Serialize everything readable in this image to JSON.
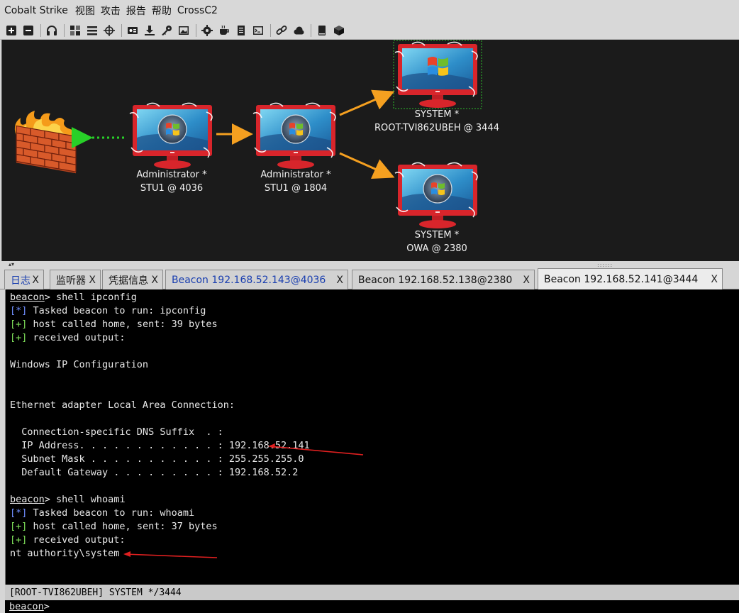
{
  "menu": {
    "items": [
      "Cobalt Strike",
      "视图",
      "攻击",
      "报告",
      "帮助",
      "CrossC2"
    ]
  },
  "toolbar": {
    "icons": [
      "add-icon",
      "remove-icon",
      "headphones-icon",
      "network-icon",
      "list-icon",
      "crosshair-icon",
      "credentials-icon",
      "download-icon",
      "key-icon",
      "image-icon",
      "gear-icon",
      "coffee-icon",
      "document-icon",
      "terminal-icon",
      "link-icon",
      "cloud-icon",
      "book-icon",
      "cube-icon"
    ]
  },
  "graph": {
    "nodes": [
      {
        "user": "Administrator *",
        "host": "STU1 @ 4036"
      },
      {
        "user": "Administrator *",
        "host": "STU1 @ 1804"
      },
      {
        "user": "SYSTEM *",
        "host": "ROOT-TVI862UBEH @ 3444"
      },
      {
        "user": "SYSTEM *",
        "host": "OWA @ 2380"
      }
    ],
    "colors": {
      "background": "#1b1b1b",
      "pivot_arrow": "#f5a020",
      "egress_arrow": "#28d028",
      "monitor": "#d8252b",
      "selection": "#2dbb2d"
    }
  },
  "tabs": [
    {
      "label": "日志",
      "close": "X"
    },
    {
      "label": "监听器",
      "close": "X"
    },
    {
      "label": "凭据信息",
      "close": "X"
    },
    {
      "label": "Beacon 192.168.52.143@4036",
      "close": "X"
    },
    {
      "label": "Beacon 192.168.52.138@2380",
      "close": "X"
    },
    {
      "label": "Beacon 192.168.52.141@3444",
      "close": "X"
    }
  ],
  "console": {
    "prompt": "beacon",
    "cmd1": "> shell ipconfig",
    "tasked_tag": "[*]",
    "ok_tag": "[+]",
    "task1": " Tasked beacon to run: ipconfig",
    "host1": " host called home, sent: 39 bytes",
    "recv": " received output:",
    "winip": "Windows IP Configuration",
    "ethernet": "Ethernet adapter Local Area Connection:",
    "dns": "  Connection-specific DNS Suffix  . :",
    "ip": "  IP Address. . . . . . . . . . . . : 192.168.52.141",
    "mask": "  Subnet Mask . . . . . . . . . . . : 255.255.255.0",
    "gw": "  Default Gateway . . . . . . . . . : 192.168.52.2",
    "cmd2": "> shell whoami",
    "task2": " Tasked beacon to run: whoami",
    "host2": " host called home, sent: 37 bytes",
    "whoami": "nt authority\\system"
  },
  "status": {
    "text": "[ROOT-TVI862UBEH] SYSTEM */3444"
  },
  "input": {
    "prompt": "beacon",
    "suffix": ">",
    "value": ""
  }
}
